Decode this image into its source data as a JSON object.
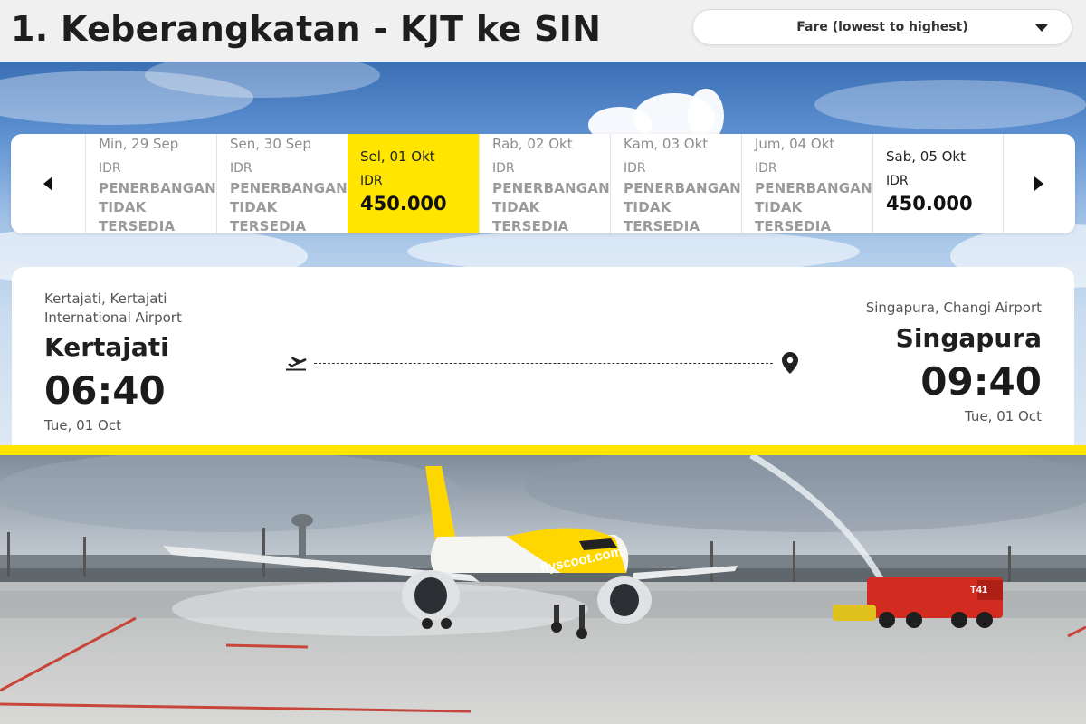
{
  "header": {
    "title": "1. Keberangkatan - KJT ke SIN",
    "sort": {
      "selected": "Fare (lowest to highest)"
    }
  },
  "date_strip": {
    "days": [
      {
        "label": "Min, 29 Sep",
        "currency": "IDR",
        "status": "PENERBANGAN TIDAK TERSEDIA"
      },
      {
        "label": "Sen, 30 Sep",
        "currency": "IDR",
        "status": "PENERBANGAN TIDAK TERSEDIA"
      },
      {
        "label": "Sel, 01 Okt",
        "currency": "IDR",
        "price": "450.000"
      },
      {
        "label": "Rab, 02 Okt",
        "currency": "IDR",
        "status": "PENERBANGAN TIDAK TERSEDIA"
      },
      {
        "label": "Kam, 03 Okt",
        "currency": "IDR",
        "status": "PENERBANGAN TIDAK TERSEDIA"
      },
      {
        "label": "Jum, 04 Okt",
        "currency": "IDR",
        "status": "PENERBANGAN TIDAK TERSEDIA"
      },
      {
        "label": "Sab, 05 Okt",
        "currency": "IDR",
        "price": "450.000"
      }
    ]
  },
  "flight": {
    "origin": {
      "airport": "Kertajati, Kertajati International Airport",
      "city": "Kertajati",
      "time": "06:40",
      "date": "Tue, 01 Oct"
    },
    "destination": {
      "airport": "Singapura, Changi Airport",
      "city": "Singapura",
      "time": "09:40",
      "date": "Tue, 01 Oct"
    }
  },
  "photo": {
    "aircraft_livery": "flyscoot.com",
    "truck_label": "T41"
  },
  "colors": {
    "brand_yellow": "#ffe500",
    "text_dark": "#1e1e1e",
    "unavailable_gray": "#9a9a9a"
  },
  "icons": {
    "prev": "chevron-left-icon",
    "next": "chevron-right-icon",
    "sort": "caret-down-icon",
    "departure": "plane-takeoff-icon",
    "arrival": "location-pin-icon"
  }
}
